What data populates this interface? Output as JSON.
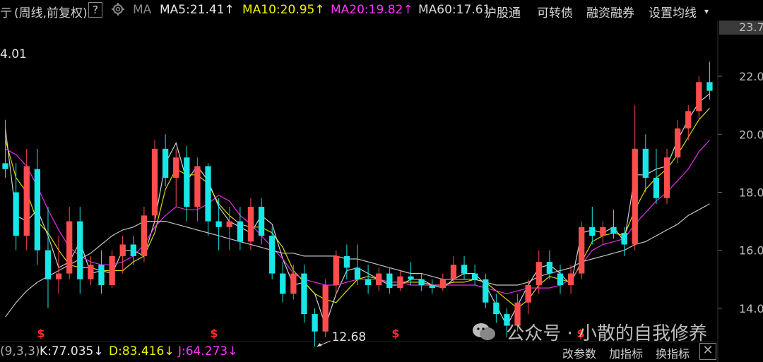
{
  "header": {
    "title_partial": "亍",
    "mode": "(周线,前复权)",
    "help": "?",
    "ma_label": "MA",
    "ma5": "MA5:21.41",
    "ma10": "MA10:20.95",
    "ma20": "MA20:19.82",
    "ma60": "MA60:17.61",
    "up_arrow": "↑",
    "menu": [
      "沪股通",
      "可转债",
      "融资融券",
      "设置均线"
    ],
    "dropdown": "▾"
  },
  "indicator": {
    "params": "(9,3,3)",
    "k": "K:77.035",
    "d": "D:83.416",
    "j": "J:64.273",
    "down_arrow": "↓",
    "buttons": [
      "改参数",
      "加指标",
      "换指标"
    ],
    "close": "✕"
  },
  "watermark": {
    "text": "公众号 · 小散的自我修养"
  },
  "colors": {
    "up": "#ff4d4d",
    "down": "#19e6e6",
    "ma5": "#e8e8e8",
    "ma10": "#f2f200",
    "ma20": "#ff33ff",
    "ma60": "#d8d8d8",
    "kdj_k": "#e8e8e8",
    "kdj_d": "#f2f200",
    "kdj_j": "#ff33ff"
  },
  "chart_data": {
    "type": "candlestick",
    "title": "",
    "ylim": [
      13.0,
      23.9
    ],
    "y_ticks": [
      "23.7",
      "22.0",
      "20.0",
      "18.0",
      "16.0",
      "14.0"
    ],
    "y_tick_values": [
      23.7,
      22.0,
      20.0,
      18.0,
      16.0,
      14.0
    ],
    "annotations": {
      "high_label": "4.01",
      "low_label": "12.68",
      "low_value": 12.68,
      "last_price": 21.5
    },
    "markers": [
      "$",
      "$",
      "$",
      "$"
    ],
    "series": [
      {
        "name": "MA5",
        "values": [
          20.2,
          17.2,
          17.0,
          17.4,
          16.5,
          15.4,
          15.6,
          16.3,
          15.2,
          15.3,
          15.2,
          16.0,
          16.0,
          15.8,
          17.0,
          19.0,
          19.7,
          18.4,
          18.9,
          18.4,
          17.5,
          17.0,
          16.8,
          16.6,
          17.2,
          16.9,
          15.7,
          14.8,
          14.9,
          14.5,
          13.4,
          14.5,
          15.3,
          15.4,
          15.2,
          15.0,
          14.8,
          14.8,
          15.0,
          15.0,
          14.8,
          14.7,
          15.0,
          15.2,
          15.2,
          14.8,
          14.1,
          13.4,
          14.1,
          14.8,
          15.4,
          15.5,
          15.2,
          14.8,
          16.6,
          16.7,
          16.6,
          16.8,
          16.3,
          18.6,
          18.6,
          18.8,
          18.9,
          19.8,
          20.5,
          21.1,
          21.4
        ]
      },
      {
        "name": "MA10",
        "values": [
          19.8,
          18.5,
          18.0,
          17.0,
          16.6,
          16.0,
          15.5,
          15.4,
          15.4,
          15.3,
          15.3,
          15.3,
          15.6,
          15.8,
          16.6,
          18.1,
          18.8,
          18.6,
          18.6,
          18.3,
          17.6,
          17.2,
          16.9,
          16.8,
          16.8,
          16.6,
          16.1,
          15.3,
          14.9,
          14.5,
          14.3,
          14.2,
          14.6,
          15.0,
          15.1,
          15.0,
          14.9,
          14.9,
          14.9,
          14.9,
          14.8,
          14.8,
          14.9,
          14.9,
          15.0,
          14.9,
          14.6,
          14.3,
          14.0,
          14.3,
          14.8,
          15.1,
          15.0,
          14.9,
          15.6,
          16.3,
          16.5,
          16.6,
          16.5,
          17.4,
          18.1,
          18.5,
          18.8,
          19.3,
          19.9,
          20.5,
          20.9
        ]
      },
      {
        "name": "MA20",
        "values": [
          19.5,
          19.3,
          18.9,
          18.2,
          17.4,
          16.7,
          16.1,
          15.8,
          15.6,
          15.5,
          15.5,
          15.6,
          15.8,
          16.2,
          16.8,
          17.2,
          17.5,
          17.4,
          17.4,
          17.6,
          17.9,
          17.7,
          17.2,
          16.9,
          16.5,
          16.1,
          15.7,
          15.2,
          15.0,
          14.9,
          14.8,
          14.8,
          14.9,
          15.0,
          15.0,
          15.0,
          14.9,
          14.9,
          14.8,
          14.8,
          14.8,
          14.8,
          14.8,
          14.8,
          14.8,
          14.7,
          14.6,
          14.5,
          14.6,
          14.7,
          14.7,
          14.7,
          14.8,
          15.0,
          15.5,
          16.0,
          16.2,
          16.3,
          16.4,
          16.9,
          17.3,
          17.7,
          18.0,
          18.4,
          18.8,
          19.4,
          19.8
        ]
      },
      {
        "name": "MA60",
        "values": [
          13.7,
          14.2,
          14.6,
          14.9,
          15.1,
          15.3,
          15.5,
          15.7,
          15.9,
          16.2,
          16.5,
          16.7,
          16.8,
          17.0,
          17.0,
          17.0,
          16.9,
          16.8,
          16.7,
          16.6,
          16.5,
          16.4,
          16.3,
          16.2,
          16.1,
          16.0,
          15.9,
          15.9,
          15.8,
          15.8,
          15.8,
          15.8,
          15.7,
          15.7,
          15.6,
          15.5,
          15.4,
          15.3,
          15.2,
          15.2,
          15.1,
          15.0,
          15.0,
          15.0,
          15.0,
          14.9,
          14.8,
          14.8,
          14.8,
          14.9,
          15.1,
          15.2,
          15.3,
          15.4,
          15.6,
          15.7,
          15.8,
          15.9,
          16.0,
          16.2,
          16.3,
          16.5,
          16.7,
          16.9,
          17.2,
          17.4,
          17.6
        ]
      }
    ],
    "candles": [
      {
        "o": 19.0,
        "h": 20.5,
        "l": 18.5,
        "c": 18.8
      },
      {
        "o": 18.0,
        "h": 19.0,
        "l": 16.0,
        "c": 16.5
      },
      {
        "o": 16.5,
        "h": 19.5,
        "l": 16.0,
        "c": 18.9
      },
      {
        "o": 18.8,
        "h": 19.5,
        "l": 15.5,
        "c": 16.0
      },
      {
        "o": 16.0,
        "h": 17.5,
        "l": 14.0,
        "c": 15.0
      },
      {
        "o": 15.0,
        "h": 16.5,
        "l": 14.5,
        "c": 15.2
      },
      {
        "o": 15.2,
        "h": 17.5,
        "l": 15.0,
        "c": 17.0
      },
      {
        "o": 17.0,
        "h": 17.5,
        "l": 14.5,
        "c": 15.0
      },
      {
        "o": 15.0,
        "h": 15.8,
        "l": 14.8,
        "c": 15.5
      },
      {
        "o": 15.5,
        "h": 16.0,
        "l": 14.5,
        "c": 14.8
      },
      {
        "o": 14.8,
        "h": 16.0,
        "l": 14.7,
        "c": 15.8
      },
      {
        "o": 15.8,
        "h": 16.5,
        "l": 15.2,
        "c": 16.2
      },
      {
        "o": 16.2,
        "h": 16.5,
        "l": 15.5,
        "c": 15.8
      },
      {
        "o": 15.8,
        "h": 17.5,
        "l": 15.6,
        "c": 17.2
      },
      {
        "o": 17.2,
        "h": 19.8,
        "l": 17.0,
        "c": 19.5
      },
      {
        "o": 19.5,
        "h": 20.0,
        "l": 18.2,
        "c": 18.5
      },
      {
        "o": 18.5,
        "h": 19.5,
        "l": 17.5,
        "c": 19.2
      },
      {
        "o": 19.2,
        "h": 19.6,
        "l": 17.0,
        "c": 17.5
      },
      {
        "o": 17.5,
        "h": 19.2,
        "l": 17.0,
        "c": 18.9
      },
      {
        "o": 18.9,
        "h": 19.0,
        "l": 16.5,
        "c": 17.0
      },
      {
        "o": 17.0,
        "h": 17.8,
        "l": 16.0,
        "c": 16.8
      },
      {
        "o": 16.8,
        "h": 17.5,
        "l": 16.0,
        "c": 17.0
      },
      {
        "o": 17.0,
        "h": 17.5,
        "l": 16.0,
        "c": 16.3
      },
      {
        "o": 16.3,
        "h": 17.8,
        "l": 16.0,
        "c": 17.5
      },
      {
        "o": 17.5,
        "h": 17.8,
        "l": 16.2,
        "c": 16.5
      },
      {
        "o": 16.5,
        "h": 16.8,
        "l": 15.0,
        "c": 15.2
      },
      {
        "o": 15.2,
        "h": 15.6,
        "l": 14.2,
        "c": 14.5
      },
      {
        "o": 14.5,
        "h": 15.5,
        "l": 14.3,
        "c": 15.2
      },
      {
        "o": 15.2,
        "h": 15.5,
        "l": 13.5,
        "c": 13.8
      },
      {
        "o": 13.8,
        "h": 14.0,
        "l": 12.68,
        "c": 13.2
      },
      {
        "o": 13.2,
        "h": 15.0,
        "l": 13.0,
        "c": 14.8
      },
      {
        "o": 14.8,
        "h": 16.0,
        "l": 14.5,
        "c": 15.8
      },
      {
        "o": 15.8,
        "h": 16.2,
        "l": 15.0,
        "c": 15.4
      },
      {
        "o": 15.4,
        "h": 16.2,
        "l": 14.8,
        "c": 15.0
      },
      {
        "o": 15.0,
        "h": 15.5,
        "l": 14.5,
        "c": 14.8
      },
      {
        "o": 14.8,
        "h": 15.4,
        "l": 14.6,
        "c": 15.2
      },
      {
        "o": 15.2,
        "h": 15.4,
        "l": 14.5,
        "c": 14.7
      },
      {
        "o": 14.7,
        "h": 15.3,
        "l": 14.6,
        "c": 15.1
      },
      {
        "o": 15.1,
        "h": 15.6,
        "l": 14.8,
        "c": 15.0
      },
      {
        "o": 15.0,
        "h": 15.2,
        "l": 14.6,
        "c": 14.8
      },
      {
        "o": 14.8,
        "h": 15.0,
        "l": 14.5,
        "c": 14.7
      },
      {
        "o": 14.7,
        "h": 15.2,
        "l": 14.6,
        "c": 15.0
      },
      {
        "o": 15.0,
        "h": 15.8,
        "l": 14.9,
        "c": 15.5
      },
      {
        "o": 15.5,
        "h": 15.8,
        "l": 15.0,
        "c": 15.2
      },
      {
        "o": 15.2,
        "h": 15.5,
        "l": 14.8,
        "c": 15.0
      },
      {
        "o": 15.0,
        "h": 15.2,
        "l": 14.0,
        "c": 14.2
      },
      {
        "o": 14.2,
        "h": 14.5,
        "l": 13.5,
        "c": 13.8
      },
      {
        "o": 13.8,
        "h": 14.0,
        "l": 13.0,
        "c": 13.4
      },
      {
        "o": 13.4,
        "h": 14.5,
        "l": 13.2,
        "c": 14.2
      },
      {
        "o": 14.2,
        "h": 15.0,
        "l": 13.8,
        "c": 14.8
      },
      {
        "o": 14.8,
        "h": 16.0,
        "l": 14.5,
        "c": 15.6
      },
      {
        "o": 15.6,
        "h": 16.0,
        "l": 15.0,
        "c": 15.2
      },
      {
        "o": 15.2,
        "h": 15.5,
        "l": 14.5,
        "c": 14.8
      },
      {
        "o": 14.8,
        "h": 15.5,
        "l": 14.5,
        "c": 15.2
      },
      {
        "o": 15.2,
        "h": 17.0,
        "l": 15.0,
        "c": 16.8
      },
      {
        "o": 16.8,
        "h": 17.5,
        "l": 16.2,
        "c": 16.5
      },
      {
        "o": 16.5,
        "h": 17.0,
        "l": 16.2,
        "c": 16.8
      },
      {
        "o": 16.8,
        "h": 17.4,
        "l": 16.4,
        "c": 16.6
      },
      {
        "o": 16.6,
        "h": 16.8,
        "l": 15.8,
        "c": 16.2
      },
      {
        "o": 16.2,
        "h": 21.0,
        "l": 16.0,
        "c": 19.5
      },
      {
        "o": 19.5,
        "h": 20.0,
        "l": 18.0,
        "c": 18.5
      },
      {
        "o": 18.5,
        "h": 19.5,
        "l": 17.6,
        "c": 17.8
      },
      {
        "o": 17.8,
        "h": 19.5,
        "l": 17.6,
        "c": 19.2
      },
      {
        "o": 19.2,
        "h": 20.5,
        "l": 19.0,
        "c": 20.2
      },
      {
        "o": 20.2,
        "h": 21.0,
        "l": 19.8,
        "c": 20.8
      },
      {
        "o": 20.8,
        "h": 22.0,
        "l": 20.5,
        "c": 21.8
      },
      {
        "o": 21.8,
        "h": 22.5,
        "l": 21.2,
        "c": 21.5
      }
    ]
  }
}
